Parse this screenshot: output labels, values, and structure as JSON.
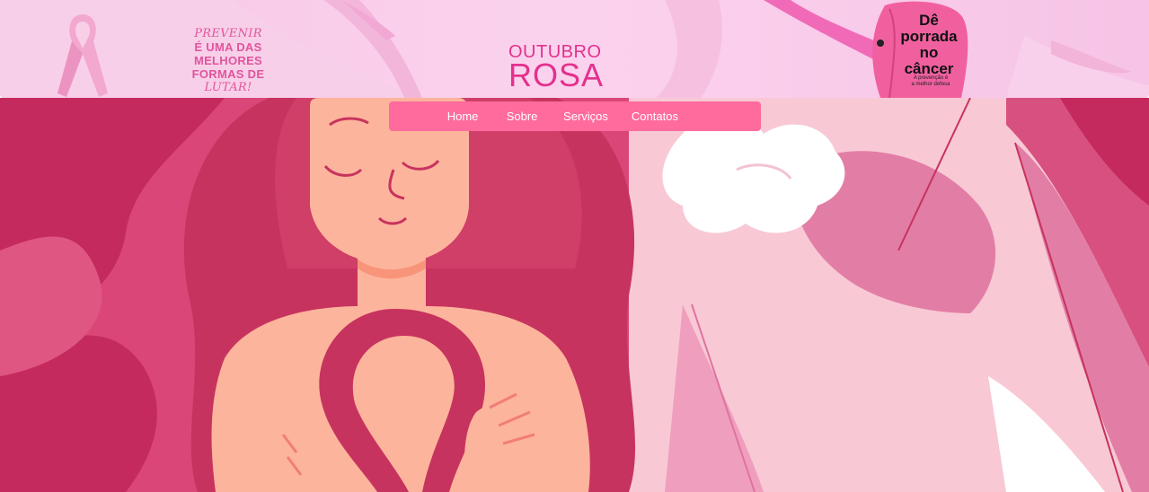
{
  "banner": {
    "slogan": [
      "PREVENIR",
      "É UMA DAS",
      "MELHORES",
      "FORMAS DE",
      "LUTAR!"
    ],
    "title_line1": "OUTUBRO",
    "title_line2": "ROSA",
    "glove_text": [
      "Dê",
      "porrada",
      "no",
      "câncer"
    ],
    "glove_sub": [
      "A prevenção é",
      "a melhor defesa"
    ]
  },
  "nav": {
    "items": [
      "Home",
      "Sobre",
      "Serviços",
      "Contatos"
    ]
  },
  "colors": {
    "nav_bg": "#ff6b9d",
    "brand_pink": "#e3318d",
    "hero_dark": "#c42a5e",
    "hero_light": "#f8c9d5"
  },
  "icons": {
    "ribbon": "pink-ribbon-icon",
    "glove": "boxing-glove-icon"
  }
}
